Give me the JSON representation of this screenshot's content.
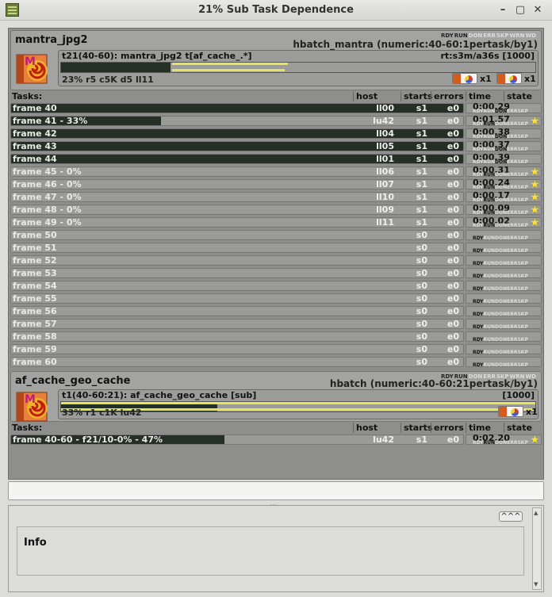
{
  "window": {
    "title": "21% Sub Task Dependence",
    "controls": [
      "minimize-icon",
      "maximize-icon",
      "close-icon"
    ]
  },
  "jobs": [
    {
      "name": "mantra_jpg2",
      "service": "hbatch_mantra (numeric:40-60:1pertask/by1)",
      "state_legend": [
        "RDY",
        "RUN",
        "DON",
        "ERR",
        "SKP",
        "WRN",
        "WD"
      ],
      "block_title": "t21(40-60): mantra_jpg2 t[af_cache_.*]",
      "block_info": "rt:s3m/a36s [1000]",
      "block_stats": "23% r5 c5K d5 ll11",
      "progress": 0.23,
      "services": [
        {
          "icon": "houdini-render-icon",
          "count": "x1"
        },
        {
          "icon": "houdini-ball-icon",
          "count": "x1"
        }
      ],
      "headers": {
        "tasks": "Tasks:",
        "host": "host",
        "starts": "starts",
        "errors": "errors",
        "time": "time",
        "state": "state"
      },
      "tasks": [
        {
          "name": "frame 40",
          "host": "ll00",
          "starts": "s1",
          "errors": "e0",
          "time": "0:00.29",
          "state": "DON",
          "progress": 1,
          "star": false
        },
        {
          "name": "frame 41 - 33%",
          "host": "lu42",
          "starts": "s1",
          "errors": "e0",
          "time": "0:01.57",
          "state": "RUN",
          "progress": 0.33,
          "star": true
        },
        {
          "name": "frame 42",
          "host": "ll04",
          "starts": "s1",
          "errors": "e0",
          "time": "0:00.38",
          "state": "DON",
          "progress": 1,
          "star": false
        },
        {
          "name": "frame 43",
          "host": "ll05",
          "starts": "s1",
          "errors": "e0",
          "time": "0:00.37",
          "state": "DON",
          "progress": 1,
          "star": false
        },
        {
          "name": "frame 44",
          "host": "ll01",
          "starts": "s1",
          "errors": "e0",
          "time": "0:00.39",
          "state": "DON",
          "progress": 1,
          "star": false
        },
        {
          "name": "frame 45 - 0%",
          "host": "ll06",
          "starts": "s1",
          "errors": "e0",
          "time": "0:00.31",
          "state": "RUN",
          "progress": 0,
          "star": true
        },
        {
          "name": "frame 46 - 0%",
          "host": "ll07",
          "starts": "s1",
          "errors": "e0",
          "time": "0:00.24",
          "state": "RUN",
          "progress": 0,
          "star": true
        },
        {
          "name": "frame 47 - 0%",
          "host": "ll10",
          "starts": "s1",
          "errors": "e0",
          "time": "0:00.17",
          "state": "RUN",
          "progress": 0,
          "star": true
        },
        {
          "name": "frame 48 - 0%",
          "host": "ll09",
          "starts": "s1",
          "errors": "e0",
          "time": "0:00.09",
          "state": "RUN",
          "progress": 0,
          "star": true
        },
        {
          "name": "frame 49 - 0%",
          "host": "ll11",
          "starts": "s1",
          "errors": "e0",
          "time": "0:00.02",
          "state": "RUN",
          "progress": 0,
          "star": true
        },
        {
          "name": "frame 50",
          "host": "",
          "starts": "s0",
          "errors": "e0",
          "time": "",
          "state": "RDY",
          "progress": 0,
          "star": false
        },
        {
          "name": "frame 51",
          "host": "",
          "starts": "s0",
          "errors": "e0",
          "time": "",
          "state": "RDY",
          "progress": 0,
          "star": false
        },
        {
          "name": "frame 52",
          "host": "",
          "starts": "s0",
          "errors": "e0",
          "time": "",
          "state": "RDY",
          "progress": 0,
          "star": false
        },
        {
          "name": "frame 53",
          "host": "",
          "starts": "s0",
          "errors": "e0",
          "time": "",
          "state": "RDY",
          "progress": 0,
          "star": false
        },
        {
          "name": "frame 54",
          "host": "",
          "starts": "s0",
          "errors": "e0",
          "time": "",
          "state": "RDY",
          "progress": 0,
          "star": false
        },
        {
          "name": "frame 55",
          "host": "",
          "starts": "s0",
          "errors": "e0",
          "time": "",
          "state": "RDY",
          "progress": 0,
          "star": false
        },
        {
          "name": "frame 56",
          "host": "",
          "starts": "s0",
          "errors": "e0",
          "time": "",
          "state": "RDY",
          "progress": 0,
          "star": false
        },
        {
          "name": "frame 57",
          "host": "",
          "starts": "s0",
          "errors": "e0",
          "time": "",
          "state": "RDY",
          "progress": 0,
          "star": false
        },
        {
          "name": "frame 58",
          "host": "",
          "starts": "s0",
          "errors": "e0",
          "time": "",
          "state": "RDY",
          "progress": 0,
          "star": false
        },
        {
          "name": "frame 59",
          "host": "",
          "starts": "s0",
          "errors": "e0",
          "time": "",
          "state": "RDY",
          "progress": 0,
          "star": false
        },
        {
          "name": "frame 60",
          "host": "",
          "starts": "s0",
          "errors": "e0",
          "time": "",
          "state": "RDY",
          "progress": 0,
          "star": false
        }
      ]
    },
    {
      "name": "af_cache_geo_cache",
      "service": "hbatch (numeric:40-60:21pertask/by1)",
      "state_legend": [
        "RDY",
        "RUN",
        "DON",
        "ERR",
        "SKP",
        "WRN",
        "WD"
      ],
      "block_title": "t1(40-60:21): af_cache_geo_cache [sub]",
      "block_info": "[1000]",
      "block_stats": "33% r1 c1K lu42",
      "progress": 0.33,
      "services": [
        {
          "icon": "houdini-ball-icon",
          "count": "x1"
        }
      ],
      "headers": {
        "tasks": "Tasks:",
        "host": "host",
        "starts": "starts",
        "errors": "errors",
        "time": "time",
        "state": "state"
      },
      "tasks": [
        {
          "name": "frame 40-60 - f21/10-0% - 47%",
          "host": "lu42",
          "starts": "s1",
          "errors": "e0",
          "time": "0:02.20",
          "state": "RUN",
          "progress": 0.47,
          "star": true
        }
      ]
    }
  ],
  "info": {
    "label": "Info",
    "collapse_label": "^^^"
  },
  "colors": {
    "panel": "#8e8e8c",
    "done": "#233023",
    "progress_yellow": "#e7e45c",
    "star": "#f6e23a"
  }
}
